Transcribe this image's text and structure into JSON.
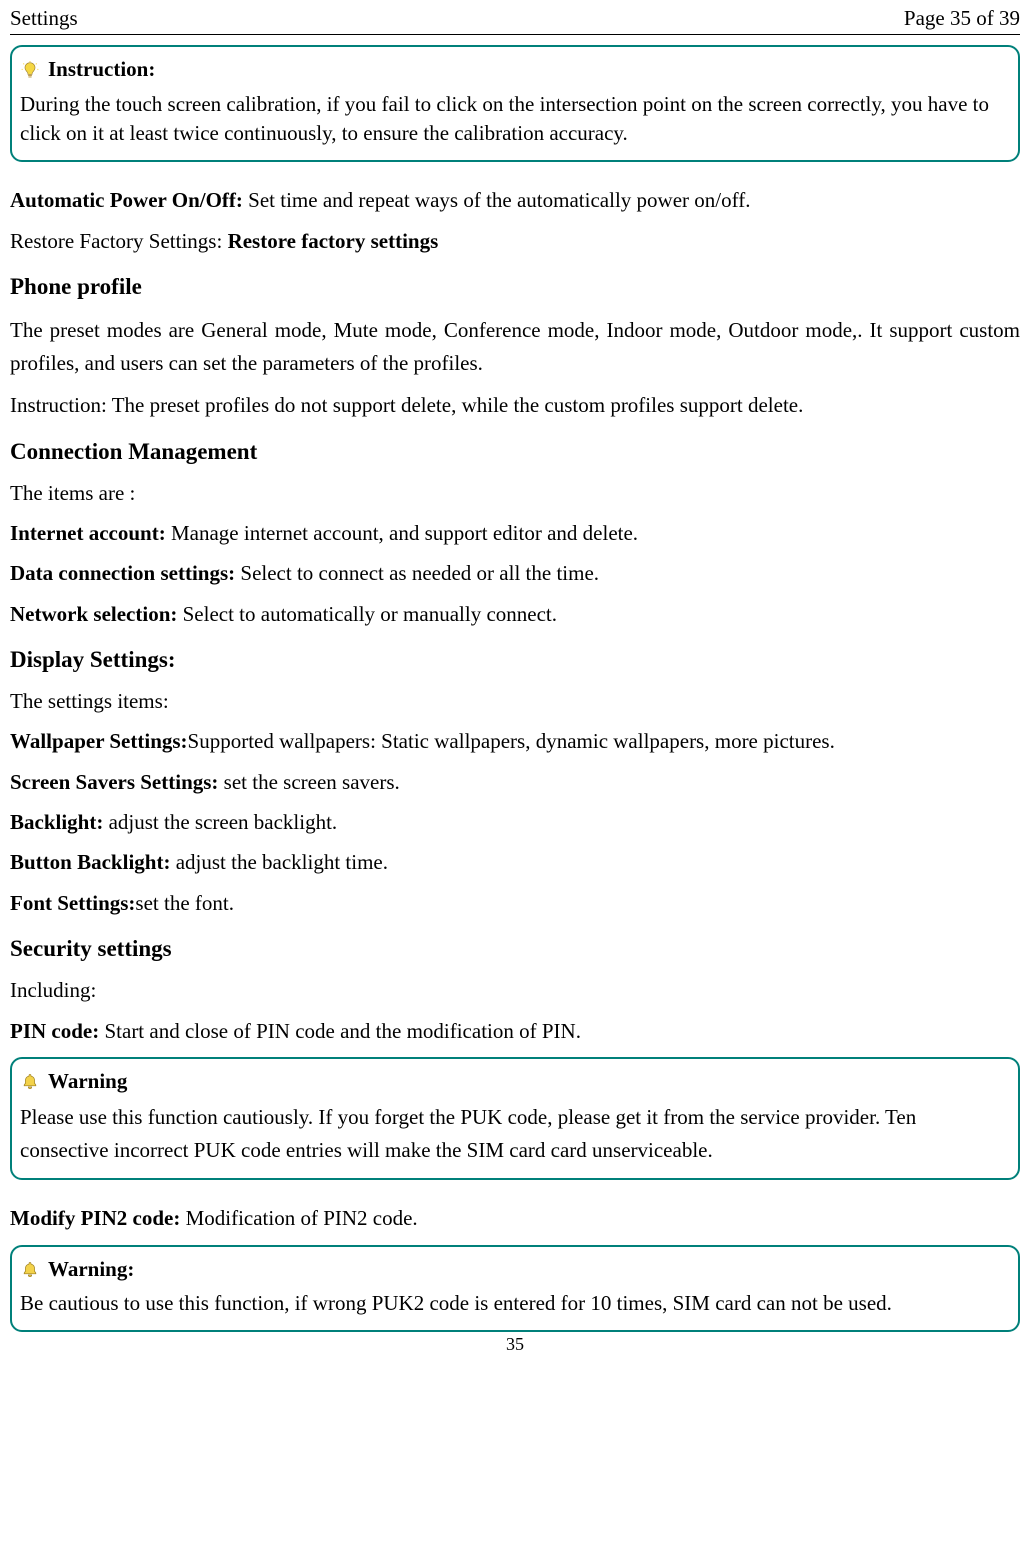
{
  "header": {
    "left": "Settings",
    "right": "Page 35 of 39"
  },
  "instructionBox": {
    "title": "Instruction:",
    "body": "During the touch screen calibration, if you fail to click on the intersection point on the screen correctly, you have to click on it at least twice continuously, to ensure the calibration accuracy."
  },
  "autoPower": {
    "label": "Automatic Power On/Off: ",
    "text": "Set time and repeat ways of the automatically power on/off."
  },
  "restoreFactory": {
    "prefix": "Restore Factory Settings: ",
    "bold": "Restore factory settings"
  },
  "phoneProfile": {
    "heading": "Phone profile",
    "p1": "The preset modes are General mode, Mute mode, Conference mode, Indoor mode, Outdoor mode,. It support custom profiles, and users can set the parameters of the profiles.",
    "p2": "Instruction: The preset profiles do not support delete, while the custom profiles support delete."
  },
  "connectionMgmt": {
    "heading": "Connection Management",
    "intro": "The items are :",
    "items": [
      {
        "label": "Internet account: ",
        "text": "Manage internet account, and support editor and delete."
      },
      {
        "label": "Data connection settings: ",
        "text": "Select to connect as needed or all the time."
      },
      {
        "label": "Network selection: ",
        "text": "Select to automatically or manually connect."
      }
    ]
  },
  "displaySettings": {
    "heading": "Display Settings:",
    "intro": "The settings items:",
    "items": [
      {
        "label": "Wallpaper Settings:",
        "text": "Supported wallpapers: Static wallpapers, dynamic wallpapers, more pictures."
      },
      {
        "label": "Screen Savers Settings: ",
        "text": "set the screen savers."
      },
      {
        "label": "Backlight: ",
        "text": "adjust the screen backlight."
      },
      {
        "label": "Button Backlight: ",
        "text": "adjust the backlight time."
      },
      {
        "label": "Font Settings:",
        "text": "set the font."
      }
    ]
  },
  "securitySettings": {
    "heading": "Security settings",
    "intro": "Including:",
    "pin": {
      "label": "PIN code: ",
      "text": "Start and close of PIN code and the modification of PIN."
    }
  },
  "warningBox1": {
    "title": "Warning",
    "body": "Please use this function cautiously. If you forget the PUK code, please get it from the service provider. Ten consective incorrect PUK code entries will make the SIM card card unserviceable."
  },
  "modifyPin2": {
    "label": "Modify PIN2 code: ",
    "text": "Modification of PIN2 code."
  },
  "warningBox2": {
    "title": "Warning:",
    "body": "Be cautious to use this function, if wrong PUK2 code is entered for 10 times, SIM card can not be used."
  },
  "pageFooter": "35"
}
